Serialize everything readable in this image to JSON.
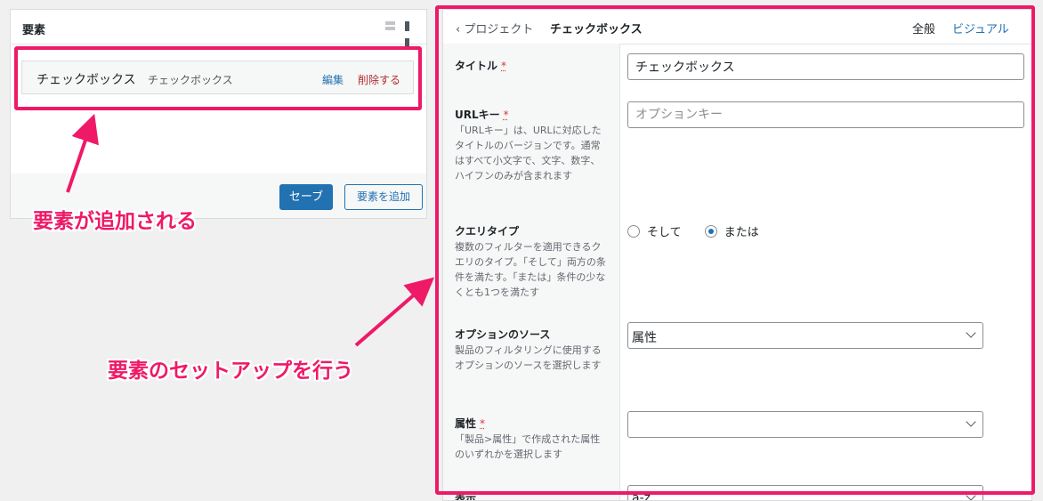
{
  "left_panel": {
    "title": "要素",
    "element": {
      "name": "チェックボックス",
      "type": "チェックボックス",
      "edit_label": "編集",
      "delete_label": "削除する"
    },
    "save_label": "セーブ",
    "add_label": "要素を追加"
  },
  "right_panel": {
    "back_label": "プロジェクト",
    "title": "チェックボックス",
    "tabs": [
      "全般",
      "ビジュアル"
    ],
    "fields": {
      "title": {
        "label": "タイトル",
        "required_mark": "*",
        "value": "チェックボックス"
      },
      "url_key": {
        "label": "URLキー",
        "required_mark": "*",
        "description": "「URLキー」は、URLに対応したタイトルのバージョンです。通常はすべて小文字で、文字、数字、ハイフンのみが含まれます",
        "placeholder": "オプションキー"
      },
      "query_type": {
        "label": "クエリタイプ",
        "description": "複数のフィルターを適用できるクエリのタイプ。「そして」両方の条件を満たす。「または」条件の少なくとも1つを満たす",
        "options": [
          "そして",
          "または"
        ],
        "selected": "または"
      },
      "option_source": {
        "label": "オプションのソース",
        "description": "製品のフィルタリングに使用するオプションのソースを選択します",
        "value": "属性"
      },
      "attribute": {
        "label": "属性",
        "required_mark": "*",
        "description": "「製品>属性」で作成された属性のいずれかを選択します",
        "value": ""
      },
      "display": {
        "label": "表示",
        "value": "a-z"
      }
    }
  },
  "annotations": {
    "left": "要素が追加される",
    "right": "要素のセットアップを行う"
  },
  "colors": {
    "highlight": "#ee1a67",
    "accent": "#2271b1",
    "danger": "#b32d2e"
  }
}
